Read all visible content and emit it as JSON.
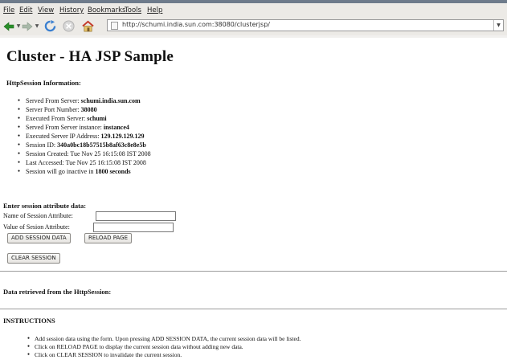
{
  "menu": [
    "File",
    "Edit",
    "View",
    "History",
    "Bookmarks",
    "Tools",
    "Help"
  ],
  "toolbar": {
    "back_icon": "back-arrow-icon",
    "forward_icon": "forward-arrow-icon",
    "reload_icon": "reload-icon",
    "stop_icon": "stop-icon",
    "home_icon": "home-icon",
    "url": "http://schumi.india.sun.com:38080/clusterjsp/"
  },
  "colors": {
    "chrome": "#eceae6",
    "nav_accent": "#2a8f2a",
    "reload": "#3a7fd0",
    "stop": "#c43a2a"
  },
  "page": {
    "title": "Cluster - HA JSP Sample",
    "httpsession_heading": "HttpSession Information:",
    "info": [
      {
        "label": "Served From Server: ",
        "value": "schumi.india.sun.com"
      },
      {
        "label": "Server Port Number: ",
        "value": "38080"
      },
      {
        "label": "Executed From Server: ",
        "value": "schumi"
      },
      {
        "label": "Served From Server instance: ",
        "value": "instance4"
      },
      {
        "label": "Executed Server IP Address: ",
        "value": "129.129.129.129"
      },
      {
        "label": "Session ID: ",
        "value": "340a0bc18b57515b8af63c8e8e5b"
      },
      {
        "label": "Session Created: Tue Nov 25 16:15:08 IST 2008",
        "value": ""
      },
      {
        "label": "Last Accessed: Tue Nov 25 16:15:08 IST 2008",
        "value": ""
      },
      {
        "label": "Session will go inactive in ",
        "value": "1800 seconds"
      }
    ],
    "form_heading": "Enter session attribute data:",
    "name_label": "Name of Session Attribute:",
    "value_label": "Value of Sesion Attribute:",
    "name_value": "",
    "value_value": "",
    "add_button": "ADD SESSION DATA",
    "reload_button": "RELOAD PAGE",
    "clear_button": "CLEAR SESSION",
    "retrieved_heading": "Data retrieved from the HttpSession:",
    "instructions_heading": "INSTRUCTIONS",
    "instructions": [
      "Add session data using the form. Upon pressing ADD SESSION DATA, the current session data will be listed.",
      "Click on RELOAD PAGE to display the current session data without adding new data.",
      "Click on CLEAR SESSION to invalidate the current session."
    ]
  }
}
